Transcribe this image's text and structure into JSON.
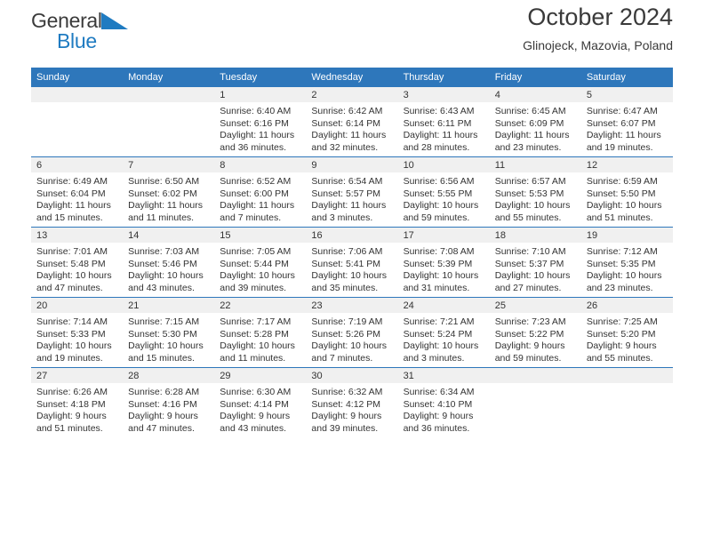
{
  "brand": {
    "name_line1": "General",
    "name_line2": "Blue",
    "accent_color": "#1f7bc1"
  },
  "header": {
    "title": "October 2024",
    "subtitle": "Glinojeck, Mazovia, Poland"
  },
  "theme": {
    "header_bg": "#2e77bb",
    "header_text": "#ffffff",
    "daynum_band_bg": "#f0f0f0",
    "row_divider": "#2e77bb",
    "text": "#333333"
  },
  "weekday_headers": [
    "Sunday",
    "Monday",
    "Tuesday",
    "Wednesday",
    "Thursday",
    "Friday",
    "Saturday"
  ],
  "labels": {
    "sunrise_prefix": "Sunrise:",
    "sunset_prefix": "Sunset:",
    "daylight_prefix": "Daylight:"
  },
  "weeks": [
    [
      {
        "day": "",
        "empty": true,
        "sunrise": "",
        "sunset": "",
        "daylight": ""
      },
      {
        "day": "",
        "empty": true,
        "sunrise": "",
        "sunset": "",
        "daylight": ""
      },
      {
        "day": "1",
        "empty": false,
        "sunrise": "Sunrise: 6:40 AM",
        "sunset": "Sunset: 6:16 PM",
        "daylight": "Daylight: 11 hours and 36 minutes."
      },
      {
        "day": "2",
        "empty": false,
        "sunrise": "Sunrise: 6:42 AM",
        "sunset": "Sunset: 6:14 PM",
        "daylight": "Daylight: 11 hours and 32 minutes."
      },
      {
        "day": "3",
        "empty": false,
        "sunrise": "Sunrise: 6:43 AM",
        "sunset": "Sunset: 6:11 PM",
        "daylight": "Daylight: 11 hours and 28 minutes."
      },
      {
        "day": "4",
        "empty": false,
        "sunrise": "Sunrise: 6:45 AM",
        "sunset": "Sunset: 6:09 PM",
        "daylight": "Daylight: 11 hours and 23 minutes."
      },
      {
        "day": "5",
        "empty": false,
        "sunrise": "Sunrise: 6:47 AM",
        "sunset": "Sunset: 6:07 PM",
        "daylight": "Daylight: 11 hours and 19 minutes."
      }
    ],
    [
      {
        "day": "6",
        "empty": false,
        "sunrise": "Sunrise: 6:49 AM",
        "sunset": "Sunset: 6:04 PM",
        "daylight": "Daylight: 11 hours and 15 minutes."
      },
      {
        "day": "7",
        "empty": false,
        "sunrise": "Sunrise: 6:50 AM",
        "sunset": "Sunset: 6:02 PM",
        "daylight": "Daylight: 11 hours and 11 minutes."
      },
      {
        "day": "8",
        "empty": false,
        "sunrise": "Sunrise: 6:52 AM",
        "sunset": "Sunset: 6:00 PM",
        "daylight": "Daylight: 11 hours and 7 minutes."
      },
      {
        "day": "9",
        "empty": false,
        "sunrise": "Sunrise: 6:54 AM",
        "sunset": "Sunset: 5:57 PM",
        "daylight": "Daylight: 11 hours and 3 minutes."
      },
      {
        "day": "10",
        "empty": false,
        "sunrise": "Sunrise: 6:56 AM",
        "sunset": "Sunset: 5:55 PM",
        "daylight": "Daylight: 10 hours and 59 minutes."
      },
      {
        "day": "11",
        "empty": false,
        "sunrise": "Sunrise: 6:57 AM",
        "sunset": "Sunset: 5:53 PM",
        "daylight": "Daylight: 10 hours and 55 minutes."
      },
      {
        "day": "12",
        "empty": false,
        "sunrise": "Sunrise: 6:59 AM",
        "sunset": "Sunset: 5:50 PM",
        "daylight": "Daylight: 10 hours and 51 minutes."
      }
    ],
    [
      {
        "day": "13",
        "empty": false,
        "sunrise": "Sunrise: 7:01 AM",
        "sunset": "Sunset: 5:48 PM",
        "daylight": "Daylight: 10 hours and 47 minutes."
      },
      {
        "day": "14",
        "empty": false,
        "sunrise": "Sunrise: 7:03 AM",
        "sunset": "Sunset: 5:46 PM",
        "daylight": "Daylight: 10 hours and 43 minutes."
      },
      {
        "day": "15",
        "empty": false,
        "sunrise": "Sunrise: 7:05 AM",
        "sunset": "Sunset: 5:44 PM",
        "daylight": "Daylight: 10 hours and 39 minutes."
      },
      {
        "day": "16",
        "empty": false,
        "sunrise": "Sunrise: 7:06 AM",
        "sunset": "Sunset: 5:41 PM",
        "daylight": "Daylight: 10 hours and 35 minutes."
      },
      {
        "day": "17",
        "empty": false,
        "sunrise": "Sunrise: 7:08 AM",
        "sunset": "Sunset: 5:39 PM",
        "daylight": "Daylight: 10 hours and 31 minutes."
      },
      {
        "day": "18",
        "empty": false,
        "sunrise": "Sunrise: 7:10 AM",
        "sunset": "Sunset: 5:37 PM",
        "daylight": "Daylight: 10 hours and 27 minutes."
      },
      {
        "day": "19",
        "empty": false,
        "sunrise": "Sunrise: 7:12 AM",
        "sunset": "Sunset: 5:35 PM",
        "daylight": "Daylight: 10 hours and 23 minutes."
      }
    ],
    [
      {
        "day": "20",
        "empty": false,
        "sunrise": "Sunrise: 7:14 AM",
        "sunset": "Sunset: 5:33 PM",
        "daylight": "Daylight: 10 hours and 19 minutes."
      },
      {
        "day": "21",
        "empty": false,
        "sunrise": "Sunrise: 7:15 AM",
        "sunset": "Sunset: 5:30 PM",
        "daylight": "Daylight: 10 hours and 15 minutes."
      },
      {
        "day": "22",
        "empty": false,
        "sunrise": "Sunrise: 7:17 AM",
        "sunset": "Sunset: 5:28 PM",
        "daylight": "Daylight: 10 hours and 11 minutes."
      },
      {
        "day": "23",
        "empty": false,
        "sunrise": "Sunrise: 7:19 AM",
        "sunset": "Sunset: 5:26 PM",
        "daylight": "Daylight: 10 hours and 7 minutes."
      },
      {
        "day": "24",
        "empty": false,
        "sunrise": "Sunrise: 7:21 AM",
        "sunset": "Sunset: 5:24 PM",
        "daylight": "Daylight: 10 hours and 3 minutes."
      },
      {
        "day": "25",
        "empty": false,
        "sunrise": "Sunrise: 7:23 AM",
        "sunset": "Sunset: 5:22 PM",
        "daylight": "Daylight: 9 hours and 59 minutes."
      },
      {
        "day": "26",
        "empty": false,
        "sunrise": "Sunrise: 7:25 AM",
        "sunset": "Sunset: 5:20 PM",
        "daylight": "Daylight: 9 hours and 55 minutes."
      }
    ],
    [
      {
        "day": "27",
        "empty": false,
        "sunrise": "Sunrise: 6:26 AM",
        "sunset": "Sunset: 4:18 PM",
        "daylight": "Daylight: 9 hours and 51 minutes."
      },
      {
        "day": "28",
        "empty": false,
        "sunrise": "Sunrise: 6:28 AM",
        "sunset": "Sunset: 4:16 PM",
        "daylight": "Daylight: 9 hours and 47 minutes."
      },
      {
        "day": "29",
        "empty": false,
        "sunrise": "Sunrise: 6:30 AM",
        "sunset": "Sunset: 4:14 PM",
        "daylight": "Daylight: 9 hours and 43 minutes."
      },
      {
        "day": "30",
        "empty": false,
        "sunrise": "Sunrise: 6:32 AM",
        "sunset": "Sunset: 4:12 PM",
        "daylight": "Daylight: 9 hours and 39 minutes."
      },
      {
        "day": "31",
        "empty": false,
        "sunrise": "Sunrise: 6:34 AM",
        "sunset": "Sunset: 4:10 PM",
        "daylight": "Daylight: 9 hours and 36 minutes."
      },
      {
        "day": "",
        "empty": true,
        "sunrise": "",
        "sunset": "",
        "daylight": ""
      },
      {
        "day": "",
        "empty": true,
        "sunrise": "",
        "sunset": "",
        "daylight": ""
      }
    ]
  ]
}
